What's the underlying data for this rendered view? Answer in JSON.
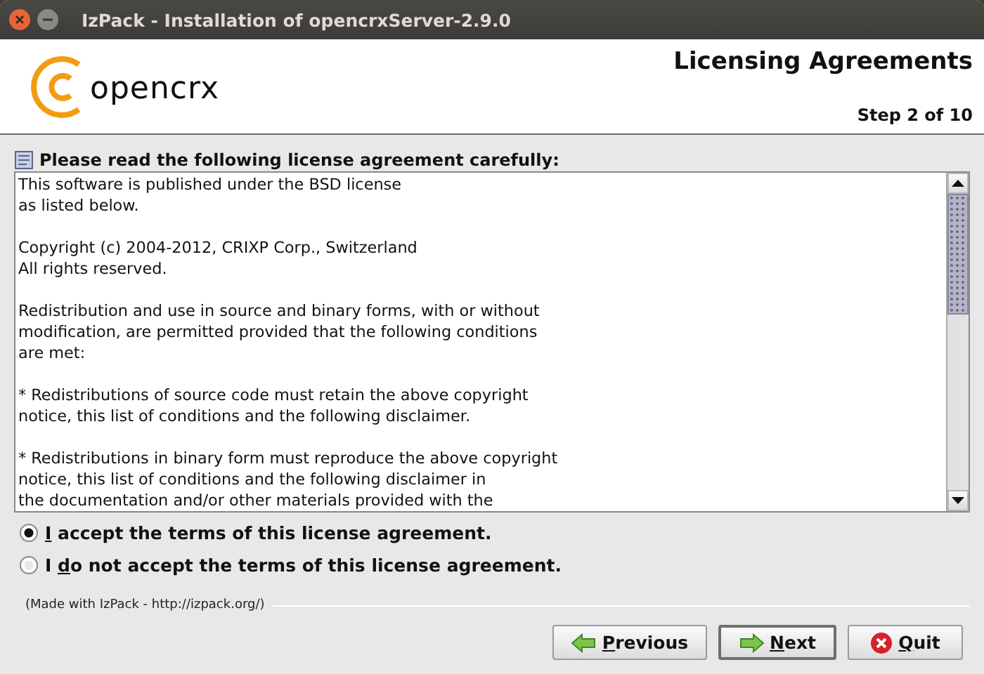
{
  "window": {
    "title": "IzPack - Installation of opencrxServer-2.9.0"
  },
  "header": {
    "logo_text": "opencrx",
    "title": "Licensing Agreements",
    "step": "Step 2 of 10"
  },
  "prompt": "Please read the following license agreement carefully:",
  "license": [
    {
      "lines": [
        "This software is published under the BSD license",
        "as listed below."
      ]
    },
    {
      "lines": [
        "Copyright (c) 2004-2012, CRIXP Corp., Switzerland",
        "All rights reserved."
      ]
    },
    {
      "lines": [
        "Redistribution and use in source and binary forms, with or without",
        "modification, are permitted provided that the following conditions",
        "are met:"
      ]
    },
    {
      "lines": [
        "* Redistributions of source code must retain the above copyright",
        "notice, this list of conditions and the following disclaimer."
      ]
    },
    {
      "lines": [
        "* Redistributions in binary form must reproduce the above copyright",
        "notice, this list of conditions and the following disclaimer in",
        "the documentation and/or other materials provided with the"
      ]
    }
  ],
  "options": [
    {
      "mnemonic": "I",
      "after": " accept the terms of this license agreement.",
      "selected": true
    },
    {
      "before": "I ",
      "mnemonic": "d",
      "after": "o not accept the terms of this license agreement.",
      "selected": false
    }
  ],
  "footer": "(Made with IzPack - http://izpack.org/)",
  "buttons": [
    {
      "kind": "previous",
      "mnemonic": "P",
      "after": "revious",
      "focused": false
    },
    {
      "kind": "next",
      "mnemonic": "N",
      "after": "ext",
      "focused": true
    },
    {
      "kind": "quit",
      "mnemonic": "Q",
      "after": "uit",
      "focused": false
    }
  ]
}
